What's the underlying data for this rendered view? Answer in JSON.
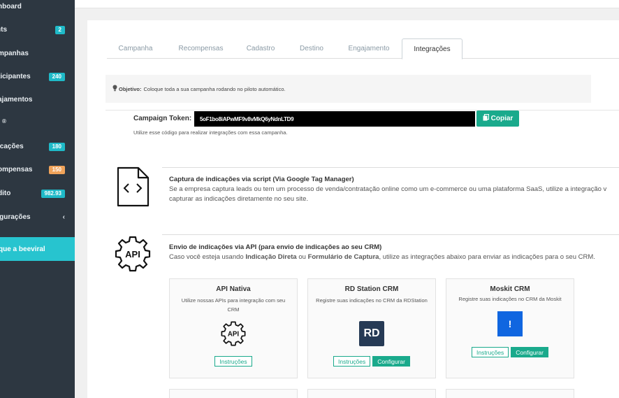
{
  "sidebar": {
    "items": [
      {
        "label": "hboard",
        "badge": ""
      },
      {
        "label": "hts",
        "badge": "2",
        "badge_color": "teal"
      },
      {
        "label": "mpanhas",
        "badge": ""
      },
      {
        "label": "ticipantes",
        "badge": "240",
        "badge_color": "teal"
      },
      {
        "label": "ajamentos",
        "badge": ""
      },
      {
        "label": "®",
        "badge": ""
      },
      {
        "label": "icações",
        "badge": "180",
        "badge_color": "teal"
      },
      {
        "label": "ompensas",
        "badge": "150",
        "badge_color": "orange"
      },
      {
        "label": "dito",
        "badge": "982.93",
        "badge_color": "teal"
      },
      {
        "label": "figurações",
        "badge": "",
        "chevron": "‹"
      }
    ],
    "cta_label": "que a beeviral"
  },
  "tabs": [
    {
      "label": "Campanha",
      "active": false
    },
    {
      "label": "Recompensas",
      "active": false
    },
    {
      "label": "Cadastro",
      "active": false
    },
    {
      "label": "Destino",
      "active": false
    },
    {
      "label": "Engajamento",
      "active": false
    },
    {
      "label": "Integrações",
      "active": true
    }
  ],
  "objective": {
    "icon": "lightbulb-icon",
    "label": "Objetivo:",
    "text": "Coloque toda a sua campanha rodando no piloto automático."
  },
  "token": {
    "label": "Campaign Token:",
    "value": "5oF1bo8iAPwMF9v8vMkQ6yNdnLTD9",
    "copy_label": "Copiar",
    "help": "Utilize esse código para realizar integrações com essa campanha."
  },
  "sections": {
    "script": {
      "title": "Captura de indicações via script (Via Google Tag Manager)",
      "desc_line1": "Se a empresa captura leads ou tem um processo de venda/contratação online como um e-commerce ou uma plataforma SaaS, utilize a integração v",
      "desc_line2": "capturar as indicações diretamente no seu site."
    },
    "api": {
      "title": "Envio de indicações via API (para envio de indicações ao seu CRM)",
      "desc_pre": "Caso você esteja usando ",
      "desc_b1": "Indicação Direta",
      "desc_mid": " ou ",
      "desc_b2": "Formulário de Captura",
      "desc_post": ", utilize as integrações abaixo para enviar as indicações para o seu CRM.",
      "icon_text": "API"
    }
  },
  "cards": [
    {
      "title": "API Nativa",
      "desc": "Utilize nossas APIs para integração com seu CRM",
      "logo_text": "API",
      "instructions_label": "Instruções",
      "configure_label": ""
    },
    {
      "title": "RD Station CRM",
      "desc": "Registre suas indicações no CRM da RDStation",
      "logo_text": "RD",
      "instructions_label": "Instruções",
      "configure_label": "Configurar"
    },
    {
      "title": "Moskit CRM",
      "desc": "Registre suas indicações no CRM da Moskit",
      "logo_text": "!",
      "instructions_label": "Instruções",
      "configure_label": "Configurar"
    }
  ],
  "colors": {
    "sidebar_bg": "#2d3741",
    "accent_teal": "#27c4cf",
    "button_green": "#1aaa8c",
    "badge_orange": "#f0a35a"
  }
}
